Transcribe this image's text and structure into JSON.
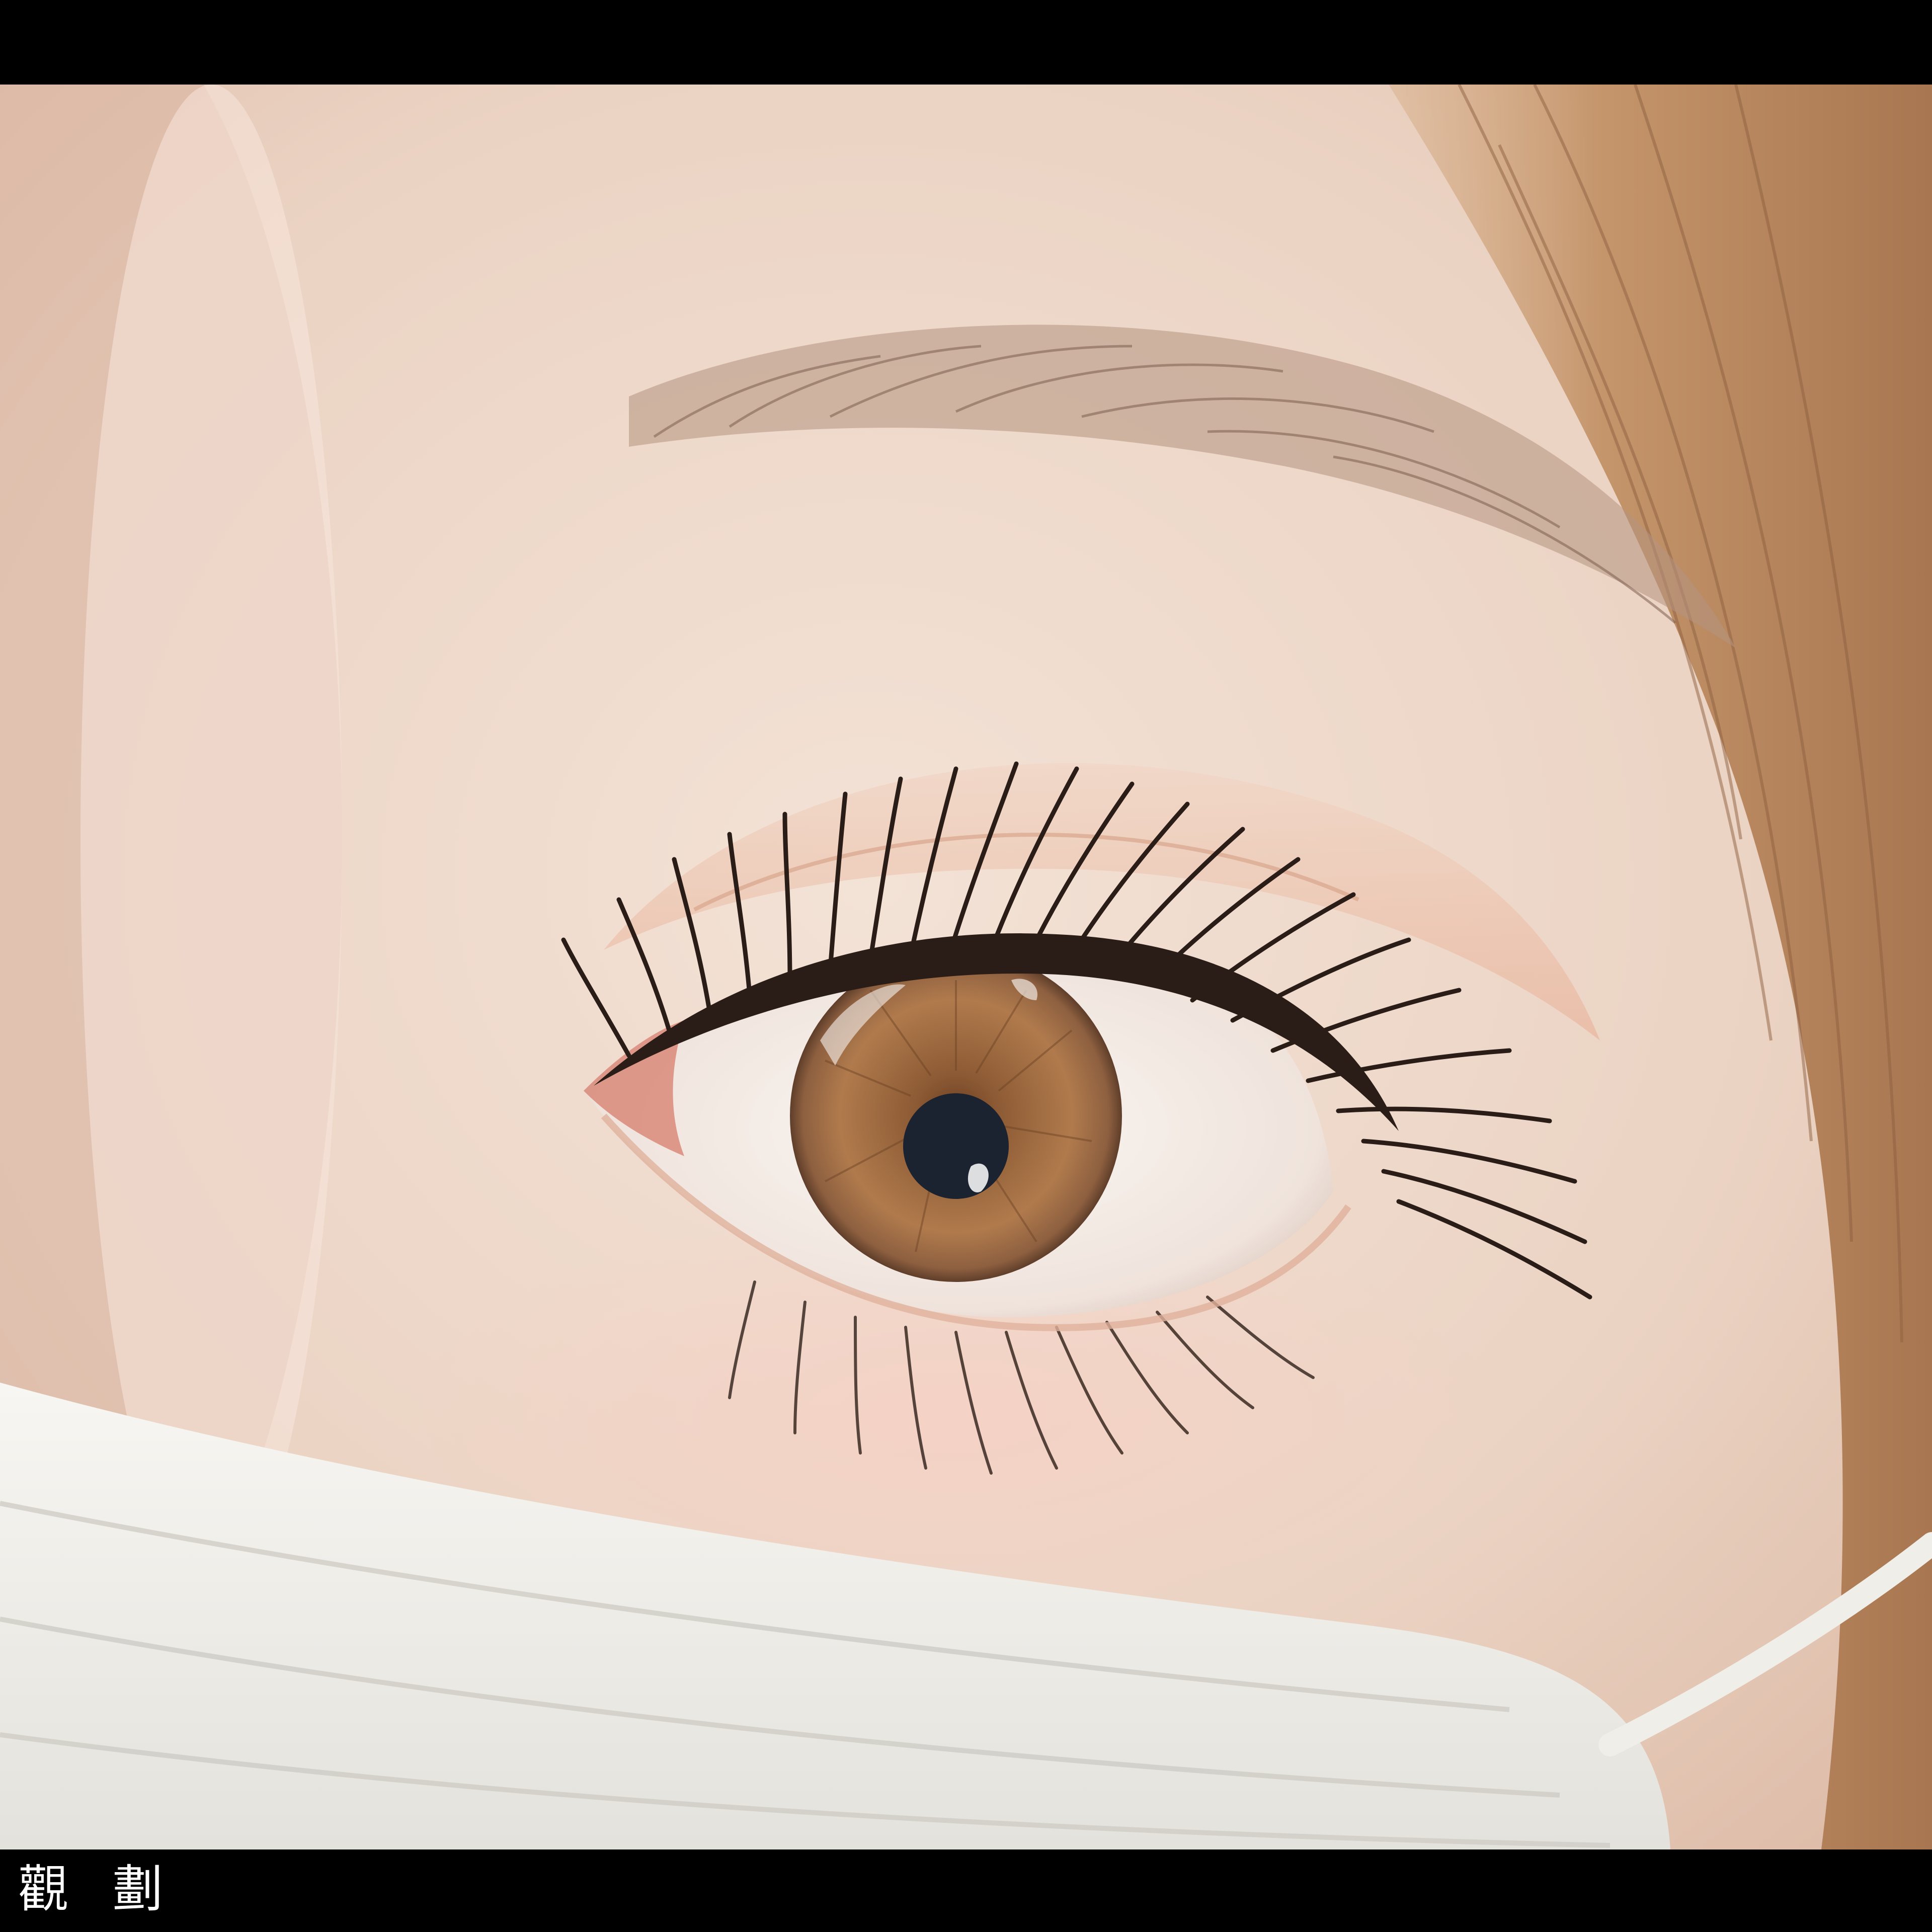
{
  "photo": {
    "subject": "close-up-eye",
    "colors": {
      "skin": "#efd9cb",
      "skin_shadow": "#d9b8a5",
      "iris": "#a06a42",
      "pupil": "#1b2230",
      "hair": "#b98a63",
      "mask": "#f1f0eb",
      "lash": "#2a1c16",
      "brow": "#8a6b58"
    }
  },
  "caption": {
    "text": "觀 劃"
  }
}
